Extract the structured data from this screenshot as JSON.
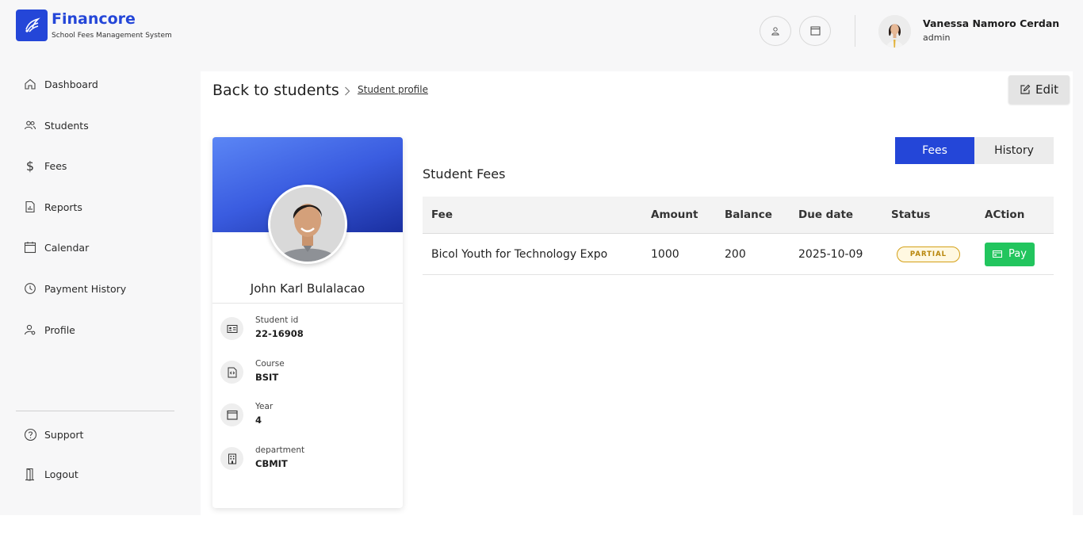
{
  "brand": {
    "name": "Financore",
    "subtitle": "School Fees Management System",
    "color": "#2446d8"
  },
  "header": {
    "icons": [
      "user-icon",
      "calendar-icon"
    ],
    "user": {
      "name": "Vanessa Namoro Cerdan",
      "role": "admin"
    }
  },
  "sidebar": {
    "items": [
      {
        "label": "Dashboard",
        "icon": "home-icon"
      },
      {
        "label": "Students",
        "icon": "users-icon"
      },
      {
        "label": "Fees",
        "icon": "dollar-icon"
      },
      {
        "label": "Reports",
        "icon": "report-icon"
      },
      {
        "label": "Calendar",
        "icon": "calendar-icon"
      },
      {
        "label": "Payment History",
        "icon": "history-icon"
      },
      {
        "label": "Profile",
        "icon": "user-settings-icon"
      }
    ],
    "bottom": [
      {
        "label": "Support",
        "icon": "help-icon"
      },
      {
        "label": "Logout",
        "icon": "door-icon"
      }
    ]
  },
  "breadcrumb": {
    "back": "Back to students",
    "current": "Student profile"
  },
  "actions": {
    "edit": "Edit"
  },
  "student": {
    "name": "John Karl Bulalacao",
    "fields": [
      {
        "label": "Student id",
        "value": "22-16908",
        "icon": "id-card-icon"
      },
      {
        "label": "Course",
        "value": "BSIT",
        "icon": "code-file-icon"
      },
      {
        "label": "Year",
        "value": "4",
        "icon": "calendar-icon"
      },
      {
        "label": "department",
        "value": "CBMIT",
        "icon": "building-icon"
      }
    ]
  },
  "tabs": {
    "fees": "Fees",
    "history": "History"
  },
  "fees": {
    "title": "Student Fees",
    "columns": [
      "Fee",
      "Amount",
      "Balance",
      "Due date",
      "Status",
      "ACtion"
    ],
    "rows": [
      {
        "fee": "Bicol Youth for Technology Expo",
        "amount": "1000",
        "balance": "200",
        "due": "2025-10-09",
        "status": "PARTIAL",
        "action": "Pay"
      }
    ],
    "status_color": "#d4a017",
    "pay_color": "#22c55e"
  }
}
